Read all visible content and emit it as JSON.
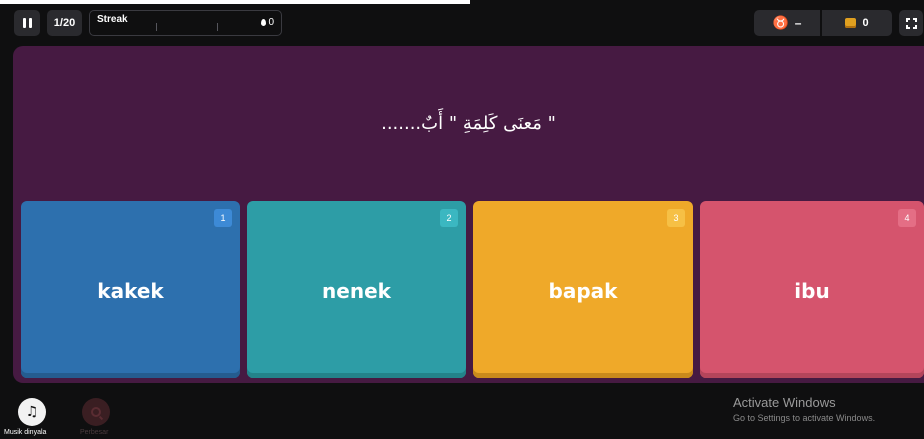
{
  "topbar": {
    "question_counter": "1/20",
    "streak_label": "Streak",
    "streak_value": "0",
    "powerup_value": "–",
    "coins_value": "0"
  },
  "icons": {
    "pause": "pause-icon",
    "flame": "flame-icon",
    "powerup": "powerup-icon",
    "coin": "coin-icon",
    "fullscreen": "fullscreen-icon",
    "music": "music-note-icon",
    "zoom": "zoom-icon"
  },
  "question": {
    "text": "\" مَعنَى كَلِمَةِ \" أَبٌ......."
  },
  "options": [
    {
      "number": "1",
      "label": "kakek",
      "color": "#2d70ae"
    },
    {
      "number": "2",
      "label": "nenek",
      "color": "#2d9da6"
    },
    {
      "number": "3",
      "label": "bapak",
      "color": "#efa929"
    },
    {
      "number": "4",
      "label": "ibu",
      "color": "#d5546d"
    }
  ],
  "bottom": {
    "music_label": "Musik dinyala",
    "zoom_label": "Perbesar"
  },
  "watermark": {
    "title": "Activate Windows",
    "subtitle": "Go to Settings to activate Windows."
  },
  "colors": {
    "stage_background": "#461a42",
    "page_background": "#0f0f10"
  }
}
